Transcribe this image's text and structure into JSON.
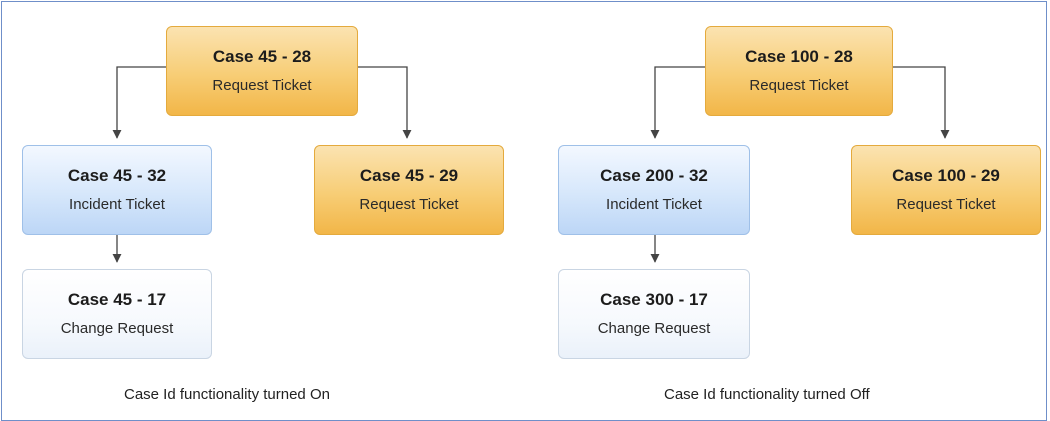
{
  "diagrams": [
    {
      "caption": "Case Id functionality turned On",
      "root": {
        "title": "Case 45 - 28",
        "type": "Request Ticket"
      },
      "left": {
        "title": "Case 45 - 32",
        "type": "Incident Ticket"
      },
      "right": {
        "title": "Case 45 - 29",
        "type": "Request Ticket"
      },
      "child": {
        "title": "Case 45 - 17",
        "type": "Change Request"
      }
    },
    {
      "caption": "Case Id functionality turned Off",
      "root": {
        "title": "Case 100 - 28",
        "type": "Request Ticket"
      },
      "left": {
        "title": "Case 200 - 32",
        "type": "Incident Ticket"
      },
      "right": {
        "title": "Case 100 - 29",
        "type": "Request Ticket"
      },
      "child": {
        "title": "Case 300 - 17",
        "type": "Change Request"
      }
    }
  ],
  "colors": {
    "request": "#f7cd75",
    "incident": "#d6e7fb",
    "change": "#f6f9fd",
    "connector": "#444444",
    "frame": "#6f8fc9"
  }
}
